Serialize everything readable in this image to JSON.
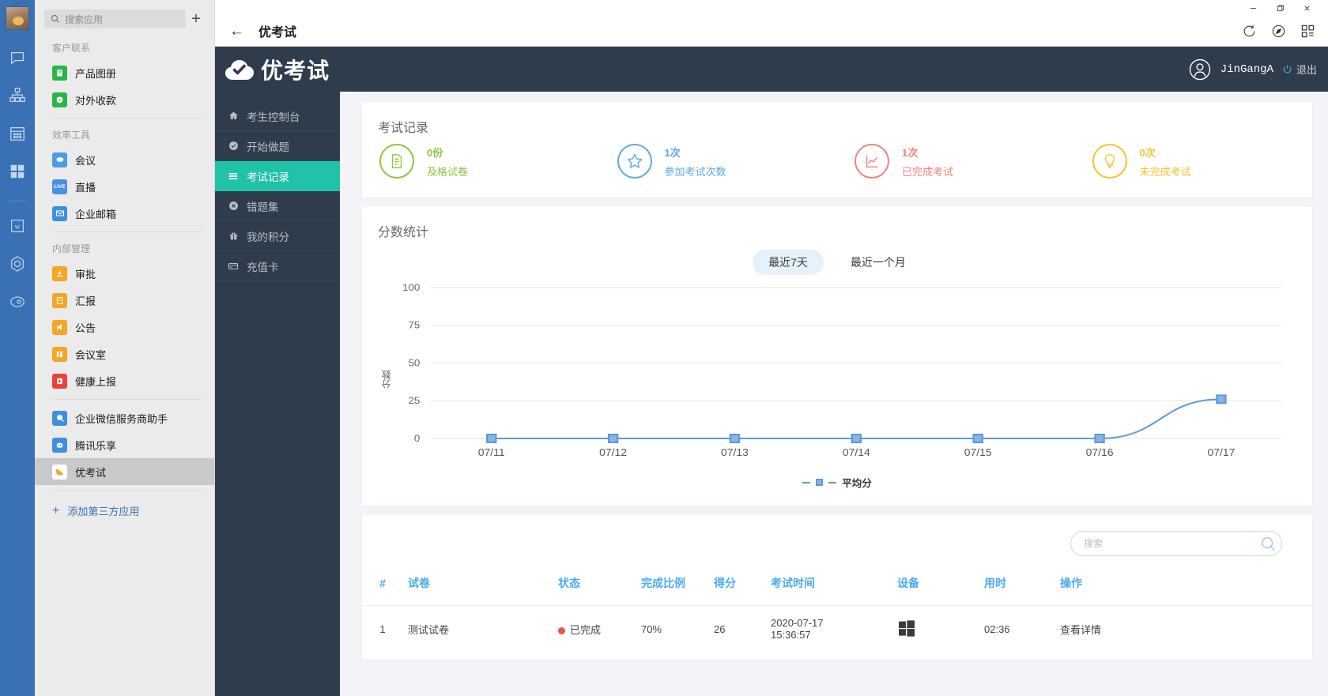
{
  "window": {
    "controls": [
      "—",
      "❐",
      "✕"
    ]
  },
  "rail": {
    "icons": [
      "avatar",
      "chat-icon",
      "contacts-icon",
      "calendar-icon",
      "workbench-icon",
      "docs-icon",
      "drive-icon",
      "cloud-icon"
    ]
  },
  "applist": {
    "search_placeholder": "搜索应用",
    "add_icon": "plus-icon",
    "groups": [
      {
        "title": "客户联系",
        "items": [
          {
            "label": "产品图册",
            "icon": "book-icon",
            "color": "#2bb44a"
          },
          {
            "label": "对外收款",
            "icon": "payment-icon",
            "color": "#2bb44a"
          }
        ]
      },
      {
        "title": "效率工具",
        "items": [
          {
            "label": "会议",
            "icon": "meeting-icon",
            "color": "#4a9ce8"
          },
          {
            "label": "直播",
            "icon": "live-icon",
            "color": "#4a90e2",
            "badge": "LIVE"
          },
          {
            "label": "企业邮箱",
            "icon": "mail-icon",
            "color": "#3e8fe0"
          }
        ]
      },
      {
        "title": "内部管理",
        "items": [
          {
            "label": "审批",
            "icon": "approval-icon",
            "color": "#f5a623"
          },
          {
            "label": "汇报",
            "icon": "report-icon",
            "color": "#f5a623"
          },
          {
            "label": "公告",
            "icon": "announce-icon",
            "color": "#f5a623"
          },
          {
            "label": "会议室",
            "icon": "meetingroom-icon",
            "color": "#f5a623"
          },
          {
            "label": "健康上报",
            "icon": "health-icon",
            "color": "#ea4335"
          }
        ]
      },
      {
        "title": "",
        "items": [
          {
            "label": "企业微信服务商助手",
            "icon": "assistant-icon",
            "color": "#3e8fe0"
          },
          {
            "label": "腾讯乐享",
            "icon": "lexiang-icon",
            "color": "#3e8fe0"
          },
          {
            "label": "优考试",
            "icon": "youkaoshi-icon",
            "color": "#ffffff",
            "active": true
          }
        ]
      }
    ],
    "add_third_party": "添加第三方应用"
  },
  "titlebar": {
    "back_icon": "back-arrow-icon",
    "title": "优考试",
    "actions": [
      "refresh-icon",
      "compass-icon",
      "grid-icon"
    ]
  },
  "webapp": {
    "logo_text": "优考试",
    "logo_icon": "cloud-check-icon",
    "user_name": "JinGangA",
    "logout_label": "退出",
    "logout_icon": "power-icon",
    "menu": [
      {
        "label": "考生控制台",
        "icon": "home-icon",
        "active": false
      },
      {
        "label": "开始做题",
        "icon": "check-circle-icon",
        "active": false
      },
      {
        "label": "考试记录",
        "icon": "list-icon",
        "active": true
      },
      {
        "label": "错题集",
        "icon": "x-circle-icon",
        "active": false
      },
      {
        "label": "我的积分",
        "icon": "gift-icon",
        "active": false
      },
      {
        "label": "充值卡",
        "icon": "card-icon",
        "active": false
      }
    ],
    "records_card": {
      "title": "考试记录",
      "stats": [
        {
          "num": "0份",
          "label": "及格试卷",
          "color": "#8dc63f",
          "icon": "paper-icon"
        },
        {
          "num": "1次",
          "label": "参加考试次数",
          "color": "#5aa9e6",
          "icon": "star-icon"
        },
        {
          "num": "1次",
          "label": "已完成考试",
          "color": "#f4817d",
          "icon": "chart-line-icon"
        },
        {
          "num": "0次",
          "label": "未完成考试",
          "color": "#f4c430",
          "icon": "bulb-icon"
        }
      ]
    },
    "score_card": {
      "title": "分数统计",
      "toggles": [
        {
          "label": "最近7天",
          "active": true
        },
        {
          "label": "最近一个月",
          "active": false
        }
      ]
    },
    "table": {
      "search_placeholder": "搜索",
      "search_value": "",
      "search_icon": "search-icon",
      "columns": [
        "#",
        "试卷",
        "状态",
        "完成比例",
        "得分",
        "考试时间",
        "设备",
        "用时",
        "操作"
      ],
      "rows": [
        {
          "index": "1",
          "paper": "测试试卷",
          "status": "已完成",
          "status_color": "#f1504a",
          "ratio": "70%",
          "score": "26",
          "time_line1": "2020-07-17",
          "time_line2": "15:36:57",
          "device": "windows-icon",
          "duration": "02:36",
          "action": "查看详情"
        }
      ]
    }
  },
  "chart_data": {
    "type": "line",
    "title": "分数统计",
    "categories": [
      "07/11",
      "07/12",
      "07/13",
      "07/14",
      "07/15",
      "07/16",
      "07/17"
    ],
    "series": [
      {
        "name": "平均分",
        "values": [
          0,
          0,
          0,
          0,
          0,
          0,
          26
        ],
        "color": "#5b9bd5"
      }
    ],
    "ylabel": "分数",
    "xlabel": "",
    "ylim": [
      0,
      100
    ],
    "yticks": [
      0,
      25,
      50,
      75,
      100
    ],
    "grid": true,
    "legend": "bottom-center"
  }
}
